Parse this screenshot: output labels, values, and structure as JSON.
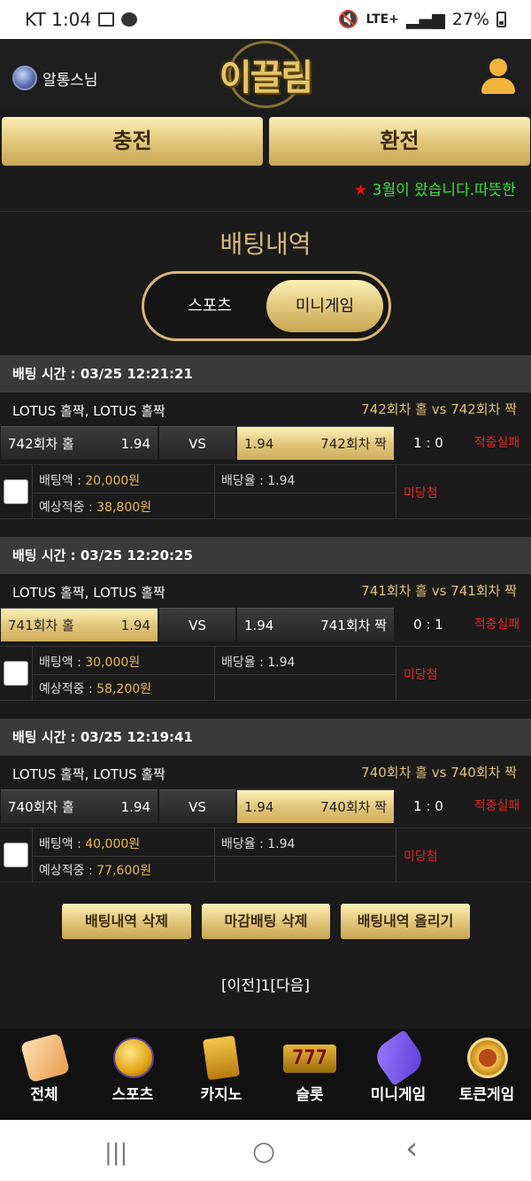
{
  "status_bar": {
    "carrier_time": "KT 1:04",
    "network": "LTE+",
    "battery": "27%"
  },
  "header": {
    "username": "알통스님",
    "logo_text": "이끌림"
  },
  "buttons": {
    "charge": "충전",
    "exchange": "환전"
  },
  "notice": {
    "star": "★",
    "text": "3월이 왔습니다.따뜻한"
  },
  "page_title": "배팅내역",
  "tabs": {
    "sports": "스포츠",
    "minigame": "미니게임",
    "active": "minigame"
  },
  "labels": {
    "bet_amount": "배팅액 : ",
    "odds": "배당율 : ",
    "expected": "예상적중 : ",
    "vs": "VS"
  },
  "bets": [
    {
      "time": "배팅 시간 : 03/25 12:21:21",
      "game": "LOTUS 홀짝, LOTUS 홀짝",
      "round": "742회차 홀  vs  742회차 짝",
      "home": "742회차 홀",
      "home_odds": "1.94",
      "away": "742회차 짝",
      "away_odds": "1.94",
      "selected": "away",
      "score": "1 : 0",
      "result": "적중실패",
      "amount": "20,000원",
      "odds": "1.94",
      "expected": "38,800원",
      "status": "미당첨"
    },
    {
      "time": "배팅 시간 : 03/25 12:20:25",
      "game": "LOTUS 홀짝, LOTUS 홀짝",
      "round": "741회차 홀  vs  741회차 짝",
      "home": "741회차 홀",
      "home_odds": "1.94",
      "away": "741회차 짝",
      "away_odds": "1.94",
      "selected": "home",
      "score": "0 : 1",
      "result": "적중실패",
      "amount": "30,000원",
      "odds": "1.94",
      "expected": "58,200원",
      "status": "미당첨"
    },
    {
      "time": "배팅 시간 : 03/25 12:19:41",
      "game": "LOTUS 홀짝, LOTUS 홀짝",
      "round": "740회차 홀  vs  740회차 짝",
      "home": "740회차 홀",
      "home_odds": "1.94",
      "away": "740회차 짝",
      "away_odds": "1.94",
      "selected": "away",
      "score": "1 : 0",
      "result": "적중실패",
      "amount": "40,000원",
      "odds": "1.94",
      "expected": "77,600원",
      "status": "미당첨"
    }
  ],
  "actions": {
    "delete_history": "배팅내역 삭제",
    "delete_closed": "마감배팅 삭제",
    "upload_history": "배팅내역 올리기"
  },
  "pager": "[이전]1[다음]",
  "bottom_nav": [
    {
      "label": "전체",
      "icon": "dice-icon"
    },
    {
      "label": "스포츠",
      "icon": "soccer-ball-icon"
    },
    {
      "label": "카지노",
      "icon": "cards-icon"
    },
    {
      "label": "슬롯",
      "icon": "slot-777-icon",
      "glyph": "777"
    },
    {
      "label": "미니게임",
      "icon": "rocket-icon"
    },
    {
      "label": "토큰게임",
      "icon": "roulette-icon"
    }
  ],
  "android_nav": {
    "recents": "|||",
    "home": "○",
    "back": "‹"
  }
}
